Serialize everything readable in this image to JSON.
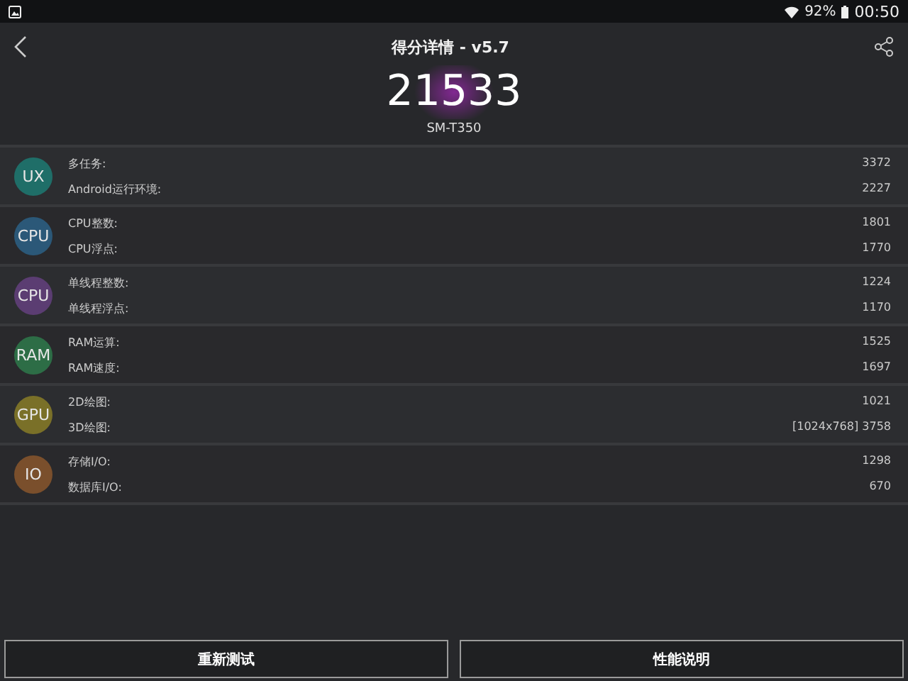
{
  "status_bar": {
    "battery": "92%",
    "time": "00:50"
  },
  "header": {
    "title": "得分详情 - v5.7"
  },
  "score": {
    "total": "21533",
    "device": "SM-T350"
  },
  "categories": [
    {
      "badge": "UX",
      "color": "#1f6e68",
      "items": [
        {
          "label": "多任务:",
          "value": "3372"
        },
        {
          "label": "Android运行环境:",
          "value": "2227"
        }
      ]
    },
    {
      "badge": "CPU",
      "color": "#2b5878",
      "items": [
        {
          "label": "CPU整数:",
          "value": "1801"
        },
        {
          "label": "CPU浮点:",
          "value": "1770"
        }
      ]
    },
    {
      "badge": "CPU",
      "color": "#5b3d72",
      "items": [
        {
          "label": "单线程整数:",
          "value": "1224"
        },
        {
          "label": "单线程浮点:",
          "value": "1170"
        }
      ]
    },
    {
      "badge": "RAM",
      "color": "#2d6d46",
      "items": [
        {
          "label": "RAM运算:",
          "value": "1525"
        },
        {
          "label": "RAM速度:",
          "value": "1697"
        }
      ]
    },
    {
      "badge": "GPU",
      "color": "#7a7028",
      "items": [
        {
          "label": "2D绘图:",
          "value": "1021"
        },
        {
          "label": "3D绘图:",
          "value": "[1024x768] 3758"
        }
      ]
    },
    {
      "badge": "IO",
      "color": "#7a4f2c",
      "items": [
        {
          "label": "存储I/O:",
          "value": "1298"
        },
        {
          "label": "数据库I/O:",
          "value": "670"
        }
      ]
    }
  ],
  "buttons": [
    "重新测试",
    "性能说明"
  ]
}
